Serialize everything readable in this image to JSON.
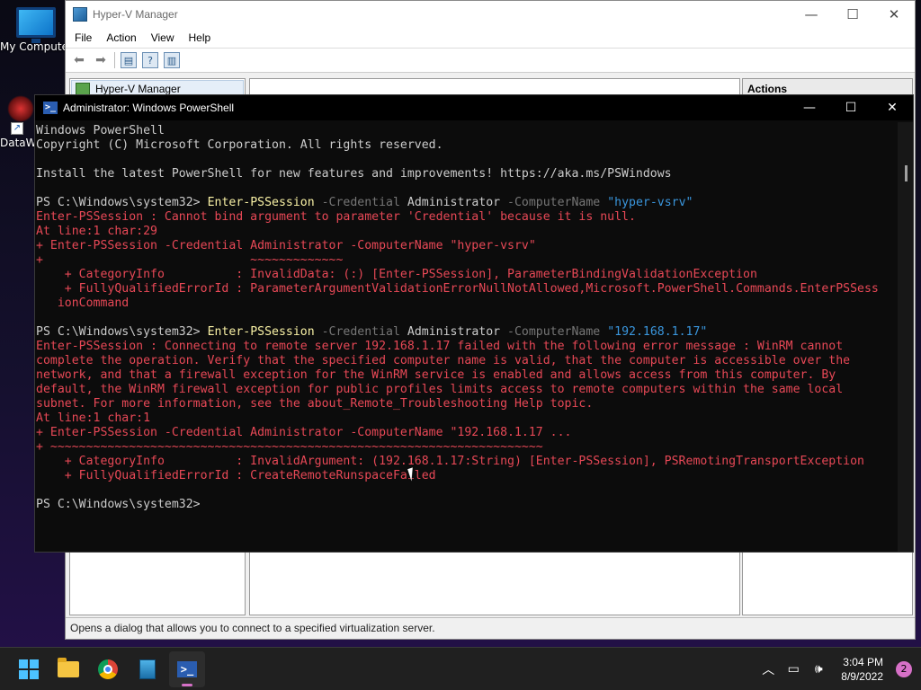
{
  "desktop": {
    "icons": [
      {
        "label": "My Computer"
      },
      {
        "label": "DataW"
      }
    ]
  },
  "hyperv": {
    "title": "Hyper-V Manager",
    "menu": [
      "File",
      "Action",
      "View",
      "Help"
    ],
    "tree_root": "Hyper-V Manager",
    "actions_header": "Actions",
    "status_text": "Opens a dialog that allows you to connect to a specified virtualization server.",
    "controls": {
      "minimize": "—",
      "maximize": "☐",
      "close": "✕"
    }
  },
  "powershell": {
    "title": "Administrator: Windows PowerShell",
    "icon_glyph": ">_",
    "controls": {
      "minimize": "—",
      "maximize": "☐",
      "close": "✕"
    },
    "lines": [
      [
        {
          "t": "Windows PowerShell",
          "c": "plain"
        }
      ],
      [
        {
          "t": "Copyright (C) Microsoft Corporation. All rights reserved.",
          "c": "plain"
        }
      ],
      [],
      [
        {
          "t": "Install the latest PowerShell for new features and improvements! https://aka.ms/PSWindows",
          "c": "plain"
        }
      ],
      [],
      [
        {
          "t": "PS C:\\Windows\\system32> ",
          "c": "plain"
        },
        {
          "t": "Enter-PSSession",
          "c": "cmd"
        },
        {
          "t": " -Credential",
          "c": "param"
        },
        {
          "t": " Administrator",
          "c": "plain"
        },
        {
          "t": " -ComputerName",
          "c": "param"
        },
        {
          "t": " \"hyper-vsrv\"",
          "c": "str"
        }
      ],
      [
        {
          "t": "Enter-PSSession : Cannot bind argument to parameter 'Credential' because it is null.",
          "c": "err"
        }
      ],
      [
        {
          "t": "At line:1 char:29",
          "c": "err"
        }
      ],
      [
        {
          "t": "+ Enter-PSSession -Credential Administrator -ComputerName \"hyper-vsrv\"",
          "c": "err"
        }
      ],
      [
        {
          "t": "+                             ~~~~~~~~~~~~~",
          "c": "err"
        }
      ],
      [
        {
          "t": "    + CategoryInfo          : InvalidData: (:) [Enter-PSSession], ParameterBindingValidationException",
          "c": "err"
        }
      ],
      [
        {
          "t": "    + FullyQualifiedErrorId : ParameterArgumentValidationErrorNullNotAllowed,Microsoft.PowerShell.Commands.EnterPSSess",
          "c": "err"
        }
      ],
      [
        {
          "t": "   ionCommand",
          "c": "err"
        }
      ],
      [],
      [
        {
          "t": "PS C:\\Windows\\system32> ",
          "c": "plain"
        },
        {
          "t": "Enter-PSSession",
          "c": "cmd"
        },
        {
          "t": " -Credential",
          "c": "param"
        },
        {
          "t": " Administrator",
          "c": "plain"
        },
        {
          "t": " -ComputerName",
          "c": "param"
        },
        {
          "t": " \"192.168.1.17\"",
          "c": "str"
        }
      ],
      [
        {
          "t": "Enter-PSSession : Connecting to remote server 192.168.1.17 failed with the following error message : WinRM cannot",
          "c": "err"
        }
      ],
      [
        {
          "t": "complete the operation. Verify that the specified computer name is valid, that the computer is accessible over the",
          "c": "err"
        }
      ],
      [
        {
          "t": "network, and that a firewall exception for the WinRM service is enabled and allows access from this computer. By",
          "c": "err"
        }
      ],
      [
        {
          "t": "default, the WinRM firewall exception for public profiles limits access to remote computers within the same local",
          "c": "err"
        }
      ],
      [
        {
          "t": "subnet. For more information, see the about_Remote_Troubleshooting Help topic.",
          "c": "err"
        }
      ],
      [
        {
          "t": "At line:1 char:1",
          "c": "err"
        }
      ],
      [
        {
          "t": "+ Enter-PSSession -Credential Administrator -ComputerName \"192.168.1.17 ...",
          "c": "err"
        }
      ],
      [
        {
          "t": "+ ~~~~~~~~~~~~~~~~~~~~~~~~~~~~~~~~~~~~~~~~~~~~~~~~~~~~~~~~~~~~~~~~~~~~~",
          "c": "err"
        }
      ],
      [
        {
          "t": "    + CategoryInfo          : InvalidArgument: (192.168.1.17:String) [Enter-PSSession], PSRemotingTransportException",
          "c": "err"
        }
      ],
      [
        {
          "t": "    + FullyQualifiedErrorId : CreateRemoteRunspaceFailed",
          "c": "err"
        }
      ],
      [],
      [
        {
          "t": "PS C:\\Windows\\system32> ",
          "c": "plain"
        }
      ]
    ]
  },
  "taskbar": {
    "apps": [
      "start",
      "file-explorer",
      "chrome",
      "hyper-v-manager",
      "powershell"
    ],
    "time": "3:04 PM",
    "date": "8/9/2022",
    "notification_count": "2",
    "tray_glyphs": {
      "chevron": "︿",
      "network": "▭",
      "volume": "🕪"
    }
  },
  "colors": {
    "console_bg": "#0c0c0c",
    "console_text": "#cccccc",
    "error": "#e74856",
    "command": "#f9f1a5",
    "parameter": "#767676",
    "string": "#3a96dd",
    "accent": "#d670c7"
  }
}
